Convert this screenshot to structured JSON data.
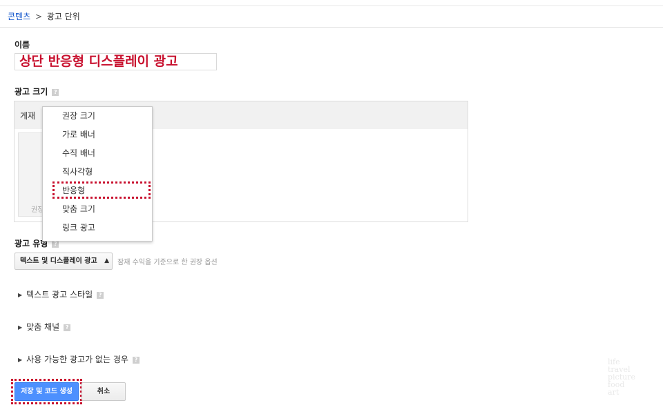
{
  "breadcrumb": {
    "parent": "콘텐츠",
    "separator": ">",
    "current": "광고 단위"
  },
  "name_field": {
    "label": "이름",
    "value": "상단 반응형 디스플레이 광고"
  },
  "ad_size": {
    "label": "광고 크기",
    "placement_label": "게재",
    "preview_label": "권장",
    "dropdown_items": [
      "권장 크기",
      "가로 배너",
      "수직 배너",
      "직사각형",
      "반응형",
      "맞춤 크기",
      "링크 광고"
    ],
    "selected_item": "반응형"
  },
  "ad_type": {
    "label": "광고 유형",
    "selected": "텍스트 및 디스플레이 광고",
    "hint": "잠재 수익을 기준으로 한 권장 옵션"
  },
  "sections": [
    "텍스트 광고 스타일",
    "맞춤 채널",
    "사용 가능한 광고가 없는 경우"
  ],
  "buttons": {
    "save": "저장 및 코드 생성",
    "cancel": "취소"
  },
  "colors": {
    "accent": "#4d90fe",
    "highlight": "#c8102e",
    "link": "#1155cc"
  },
  "icons": {
    "help": "help-icon",
    "caret": "caret-right-icon",
    "select_arrows": "select-arrows-icon"
  }
}
